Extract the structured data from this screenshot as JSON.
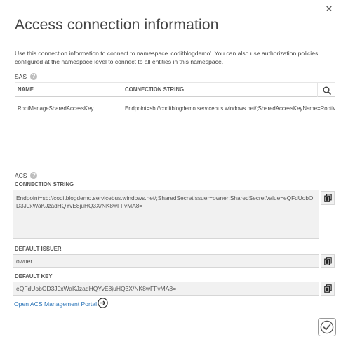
{
  "dialog": {
    "title": "Access connection information",
    "description": "Use this connection information to connect to namespace 'coditblogdemo'. You can also use authorization policies configured at the namespace level to connect to all entities in this namespace."
  },
  "sas": {
    "label": "SAS",
    "help_icon": "?",
    "columns": {
      "name": "NAME",
      "connection_string": "CONNECTION STRING"
    },
    "rows": [
      {
        "name": "RootManageSharedAccessKey",
        "connection_string": "Endpoint=sb://coditblogdemo.servicebus.windows.net/;SharedAccessKeyName=RootManageSharedAccessKey"
      }
    ]
  },
  "acs": {
    "label": "ACS",
    "help_icon": "?",
    "connection_string_label": "CONNECTION STRING",
    "connection_string": "Endpoint=sb://coditblogdemo.servicebus.windows.net/;SharedSecretIssuer=owner;SharedSecretValue=eQFdUobOD3J0xWaKJzadHQYvE8juHQ3X/NK8wFFvMA8=",
    "default_issuer_label": "DEFAULT ISSUER",
    "default_issuer": "owner",
    "default_key_label": "DEFAULT KEY",
    "default_key": "eQFdUobOD3J0xWaKJzadHQYvE8juHQ3X/NK8wFFvMA8=",
    "portal_link": "Open ACS Management Portal"
  },
  "icons": {
    "close": "close-icon",
    "search": "search-icon",
    "copy": "copy-icon",
    "arrow": "arrow-right-circle-icon",
    "ok": "checkmark-icon"
  },
  "colors": {
    "link": "#2a74b8",
    "field_bg": "#f1f1f1",
    "help_icon": "#bdbdbd"
  }
}
